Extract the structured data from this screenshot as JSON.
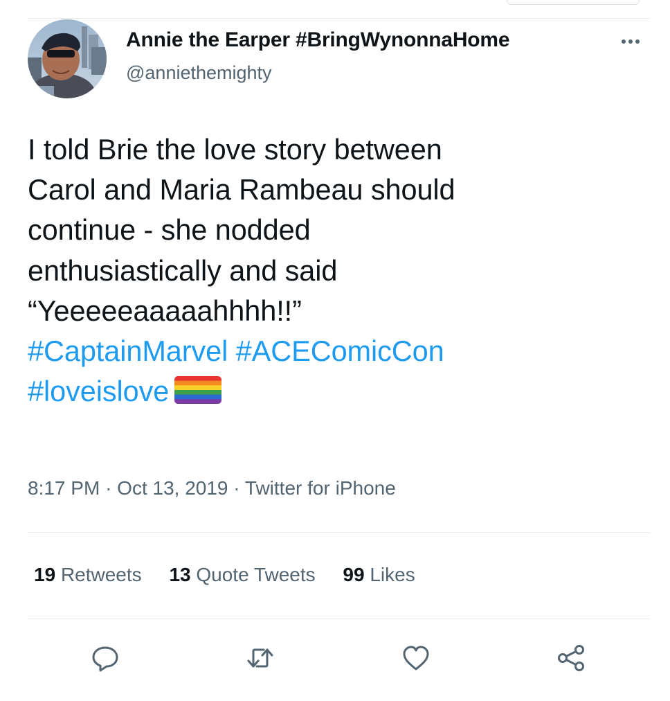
{
  "author": {
    "display_name": "Annie the Earper #BringWynonnaHome",
    "handle": "@anniethemighty"
  },
  "tweet": {
    "lines": [
      "I told Brie the love story between",
      "Carol and Maria Rambeau should",
      "continue - she nodded",
      "enthusiastically and said",
      "“Yeeeeeaaaaahhhh!!”"
    ],
    "hashtags": [
      "#CaptainMarvel",
      "#ACEComicCon",
      "#loveislove"
    ],
    "emoji": "rainbow-flag"
  },
  "meta": {
    "time": "8:17 PM",
    "separator": "·",
    "date": "Oct 13, 2019",
    "source": "Twitter for iPhone"
  },
  "stats": {
    "retweets": {
      "count": "19",
      "label": "Retweets"
    },
    "quotes": {
      "count": "13",
      "label": "Quote Tweets"
    },
    "likes": {
      "count": "99",
      "label": "Likes"
    }
  },
  "icons": {
    "more": "more-horizontal-icon",
    "reply": "reply-icon",
    "retweet": "retweet-icon",
    "like": "heart-icon",
    "share": "share-icon"
  },
  "colors": {
    "link": "#1d9bf0",
    "secondary_text": "#536471",
    "primary_text": "#0f1419",
    "divider": "#e6ecf0"
  }
}
